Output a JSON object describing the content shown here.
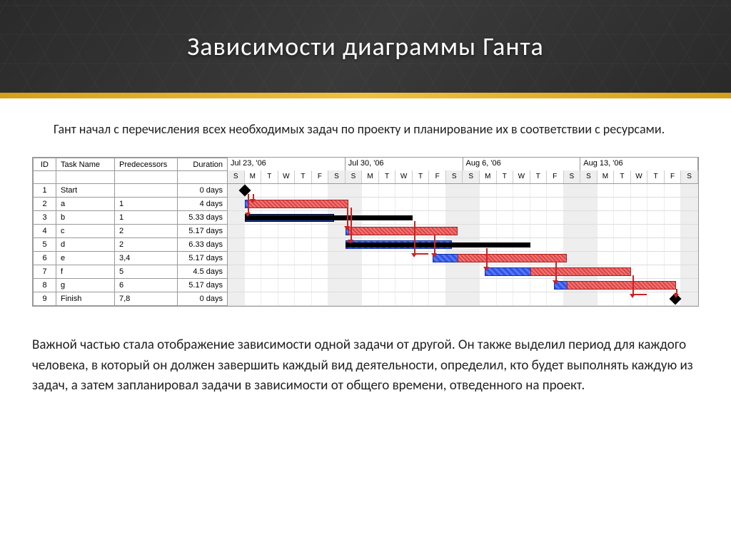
{
  "title": "Зависимости диаграммы Ганта",
  "intro": "Гант начал с перечисления всех необходимых задач по проекту и планирование их в соответствии с ресурсами.",
  "table": {
    "headers": {
      "id": "ID",
      "name": "Task Name",
      "pred": "Predecessors",
      "dur": "Duration"
    },
    "rows": [
      {
        "id": "1",
        "name": "Start",
        "pred": "",
        "dur": "0 days"
      },
      {
        "id": "2",
        "name": "a",
        "pred": "1",
        "dur": "4 days"
      },
      {
        "id": "3",
        "name": "b",
        "pred": "1",
        "dur": "5.33 days"
      },
      {
        "id": "4",
        "name": "c",
        "pred": "2",
        "dur": "5.17 days"
      },
      {
        "id": "5",
        "name": "d",
        "pred": "2",
        "dur": "6.33 days"
      },
      {
        "id": "6",
        "name": "e",
        "pred": "3,4",
        "dur": "5.17 days"
      },
      {
        "id": "7",
        "name": "f",
        "pred": "5",
        "dur": "4.5 days"
      },
      {
        "id": "8",
        "name": "g",
        "pred": "6",
        "dur": "5.17 days"
      },
      {
        "id": "9",
        "name": "Finish",
        "pred": "7,8",
        "dur": "0 days"
      }
    ]
  },
  "chart_data": {
    "type": "gantt",
    "weeks": [
      "Jul 23, '06",
      "Jul 30, '06",
      "Aug 6, '06",
      "Aug 13, '06"
    ],
    "days": [
      "S",
      "M",
      "T",
      "W",
      "T",
      "F",
      "S"
    ],
    "day_width_pct": 3.571,
    "tasks": [
      {
        "row": 0,
        "type": "milestone",
        "start": 1
      },
      {
        "row": 1,
        "type": "bar",
        "class": "blue",
        "start": 1,
        "dur": 4
      },
      {
        "row": 1,
        "type": "bar",
        "class": "red",
        "start": 1.2,
        "dur": 6
      },
      {
        "row": 2,
        "type": "bar",
        "class": "navy",
        "start": 1,
        "dur": 5.33
      },
      {
        "row": 2,
        "type": "bar",
        "class": "black",
        "start": 1,
        "dur": 10
      },
      {
        "row": 3,
        "type": "bar",
        "class": "blue",
        "start": 7,
        "dur": 5.17
      },
      {
        "row": 3,
        "type": "bar",
        "class": "red",
        "start": 7.2,
        "dur": 6.5
      },
      {
        "row": 4,
        "type": "bar",
        "class": "blue",
        "start": 7,
        "dur": 6.33
      },
      {
        "row": 4,
        "type": "bar",
        "class": "black",
        "start": 7,
        "dur": 11
      },
      {
        "row": 5,
        "type": "bar",
        "class": "blue",
        "start": 12.2,
        "dur": 5.17
      },
      {
        "row": 5,
        "type": "bar",
        "class": "red",
        "start": 13.7,
        "dur": 6.5
      },
      {
        "row": 6,
        "type": "bar",
        "class": "blue",
        "start": 15.3,
        "dur": 4.5
      },
      {
        "row": 6,
        "type": "bar",
        "class": "red",
        "start": 18,
        "dur": 6
      },
      {
        "row": 7,
        "type": "bar",
        "class": "blue",
        "start": 19.4,
        "dur": 5.17
      },
      {
        "row": 7,
        "type": "bar",
        "class": "red",
        "start": 20.2,
        "dur": 6.5
      },
      {
        "row": 8,
        "type": "milestone",
        "start": 26.6
      }
    ],
    "links": [
      {
        "from_row": 0,
        "to_row": 1,
        "x": 1.5
      },
      {
        "from_row": 0,
        "to_row": 2,
        "x": 1.2
      },
      {
        "from_row": 1,
        "to_row": 3,
        "x": 7.1
      },
      {
        "from_row": 1,
        "to_row": 4,
        "x": 7.3
      },
      {
        "from_row": 2,
        "to_row": 5,
        "x": 11.1,
        "h": true
      },
      {
        "from_row": 3,
        "to_row": 5,
        "x": 12.3
      },
      {
        "from_row": 4,
        "to_row": 6,
        "x": 15.4
      },
      {
        "from_row": 5,
        "to_row": 7,
        "x": 19.5
      },
      {
        "from_row": 6,
        "to_row": 8,
        "x": 24.1,
        "h": true
      },
      {
        "from_row": 7,
        "to_row": 8,
        "x": 26.7
      }
    ]
  },
  "bottom": "Важной частью стала отображение зависимости одной задачи от другой. Он также выделил период для каждого человека, в который он должен завершить каждый вид деятельности, определил, кто будет выполнять каждую из задач, а затем запланировал задачи в зависимости от общего времени, отведенного на проект."
}
